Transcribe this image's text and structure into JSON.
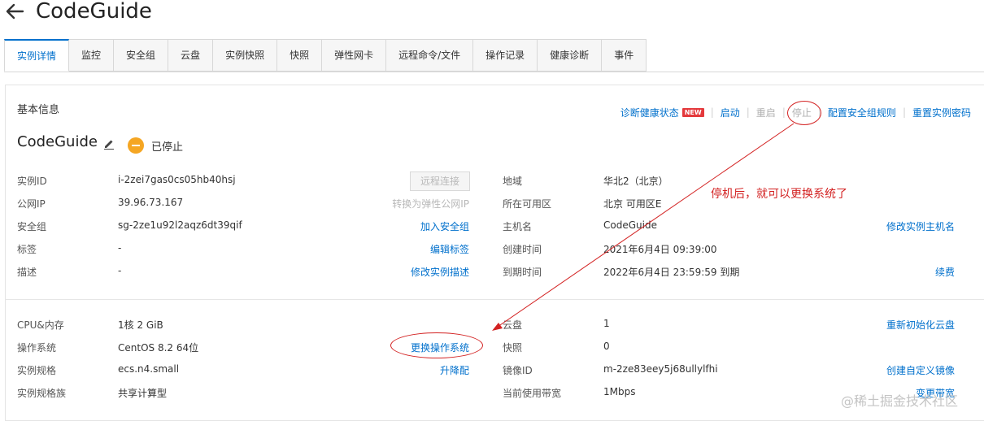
{
  "header": {
    "title": "CodeGuide",
    "back_icon": "arrow-left-icon"
  },
  "tabs": [
    {
      "label": "实例详情",
      "active": true
    },
    {
      "label": "监控"
    },
    {
      "label": "安全组"
    },
    {
      "label": "云盘"
    },
    {
      "label": "实例快照"
    },
    {
      "label": "快照"
    },
    {
      "label": "弹性网卡"
    },
    {
      "label": "远程命令/文件"
    },
    {
      "label": "操作记录"
    },
    {
      "label": "健康诊断"
    },
    {
      "label": "事件"
    }
  ],
  "section": {
    "title": "基本信息"
  },
  "actions": {
    "diagnose": "诊断健康状态",
    "new_badge": "NEW",
    "start": "启动",
    "restart": "重启",
    "stop": "停止",
    "config_sg": "配置安全组规则",
    "reset_pwd": "重置实例密码"
  },
  "instance": {
    "name": "CodeGuide",
    "status": "已停止",
    "status_color": "#f5a623"
  },
  "left_rows": [
    {
      "label": "实例ID",
      "value": "i-2zei7gas0cs05hb40hsj",
      "action": "远程连接"
    },
    {
      "label": "公网IP",
      "value": "39.96.73.167",
      "action": "转换为弹性公网IP"
    },
    {
      "label": "安全组",
      "value": "sg-2ze1u92l2aqz6dt39qif",
      "action": "加入安全组"
    },
    {
      "label": "标签",
      "value": "-",
      "action": "编辑标签"
    },
    {
      "label": "描述",
      "value": "-",
      "action": "修改实例描述"
    }
  ],
  "right_rows": [
    {
      "label": "地域",
      "value": "华北2（北京）",
      "action": ""
    },
    {
      "label": "所在可用区",
      "value": "北京 可用区E",
      "action": ""
    },
    {
      "label": "主机名",
      "value": "CodeGuide",
      "action": "修改实例主机名"
    },
    {
      "label": "创建时间",
      "value": "2021年6月4日 09:39:00",
      "action": ""
    },
    {
      "label": "到期时间",
      "value": "2022年6月4日 23:59:59 到期",
      "action": "续费"
    }
  ],
  "left_rows2": [
    {
      "label": "CPU&内存",
      "value": "1核 2 GiB",
      "action": ""
    },
    {
      "label": "操作系统",
      "value": "CentOS 8.2 64位",
      "action": "更换操作系统"
    },
    {
      "label": "实例规格",
      "value": "ecs.n4.small",
      "action": "升降配"
    },
    {
      "label": "实例规格族",
      "value": "共享计算型",
      "action": ""
    }
  ],
  "right_rows2": [
    {
      "label": "云盘",
      "value": "1",
      "action": "重新初始化云盘"
    },
    {
      "label": "快照",
      "value": "0",
      "action": ""
    },
    {
      "label": "镜像ID",
      "value": "m-2ze83eey5j68ullylfhi",
      "action": "创建自定义镜像"
    },
    {
      "label": "当前使用带宽",
      "value": "1Mbps",
      "action": "变更带宽"
    }
  ],
  "annotation": {
    "text": "停机后，就可以更换系统了",
    "color": "#d32222"
  },
  "watermark": "@稀土掘金技术社区"
}
